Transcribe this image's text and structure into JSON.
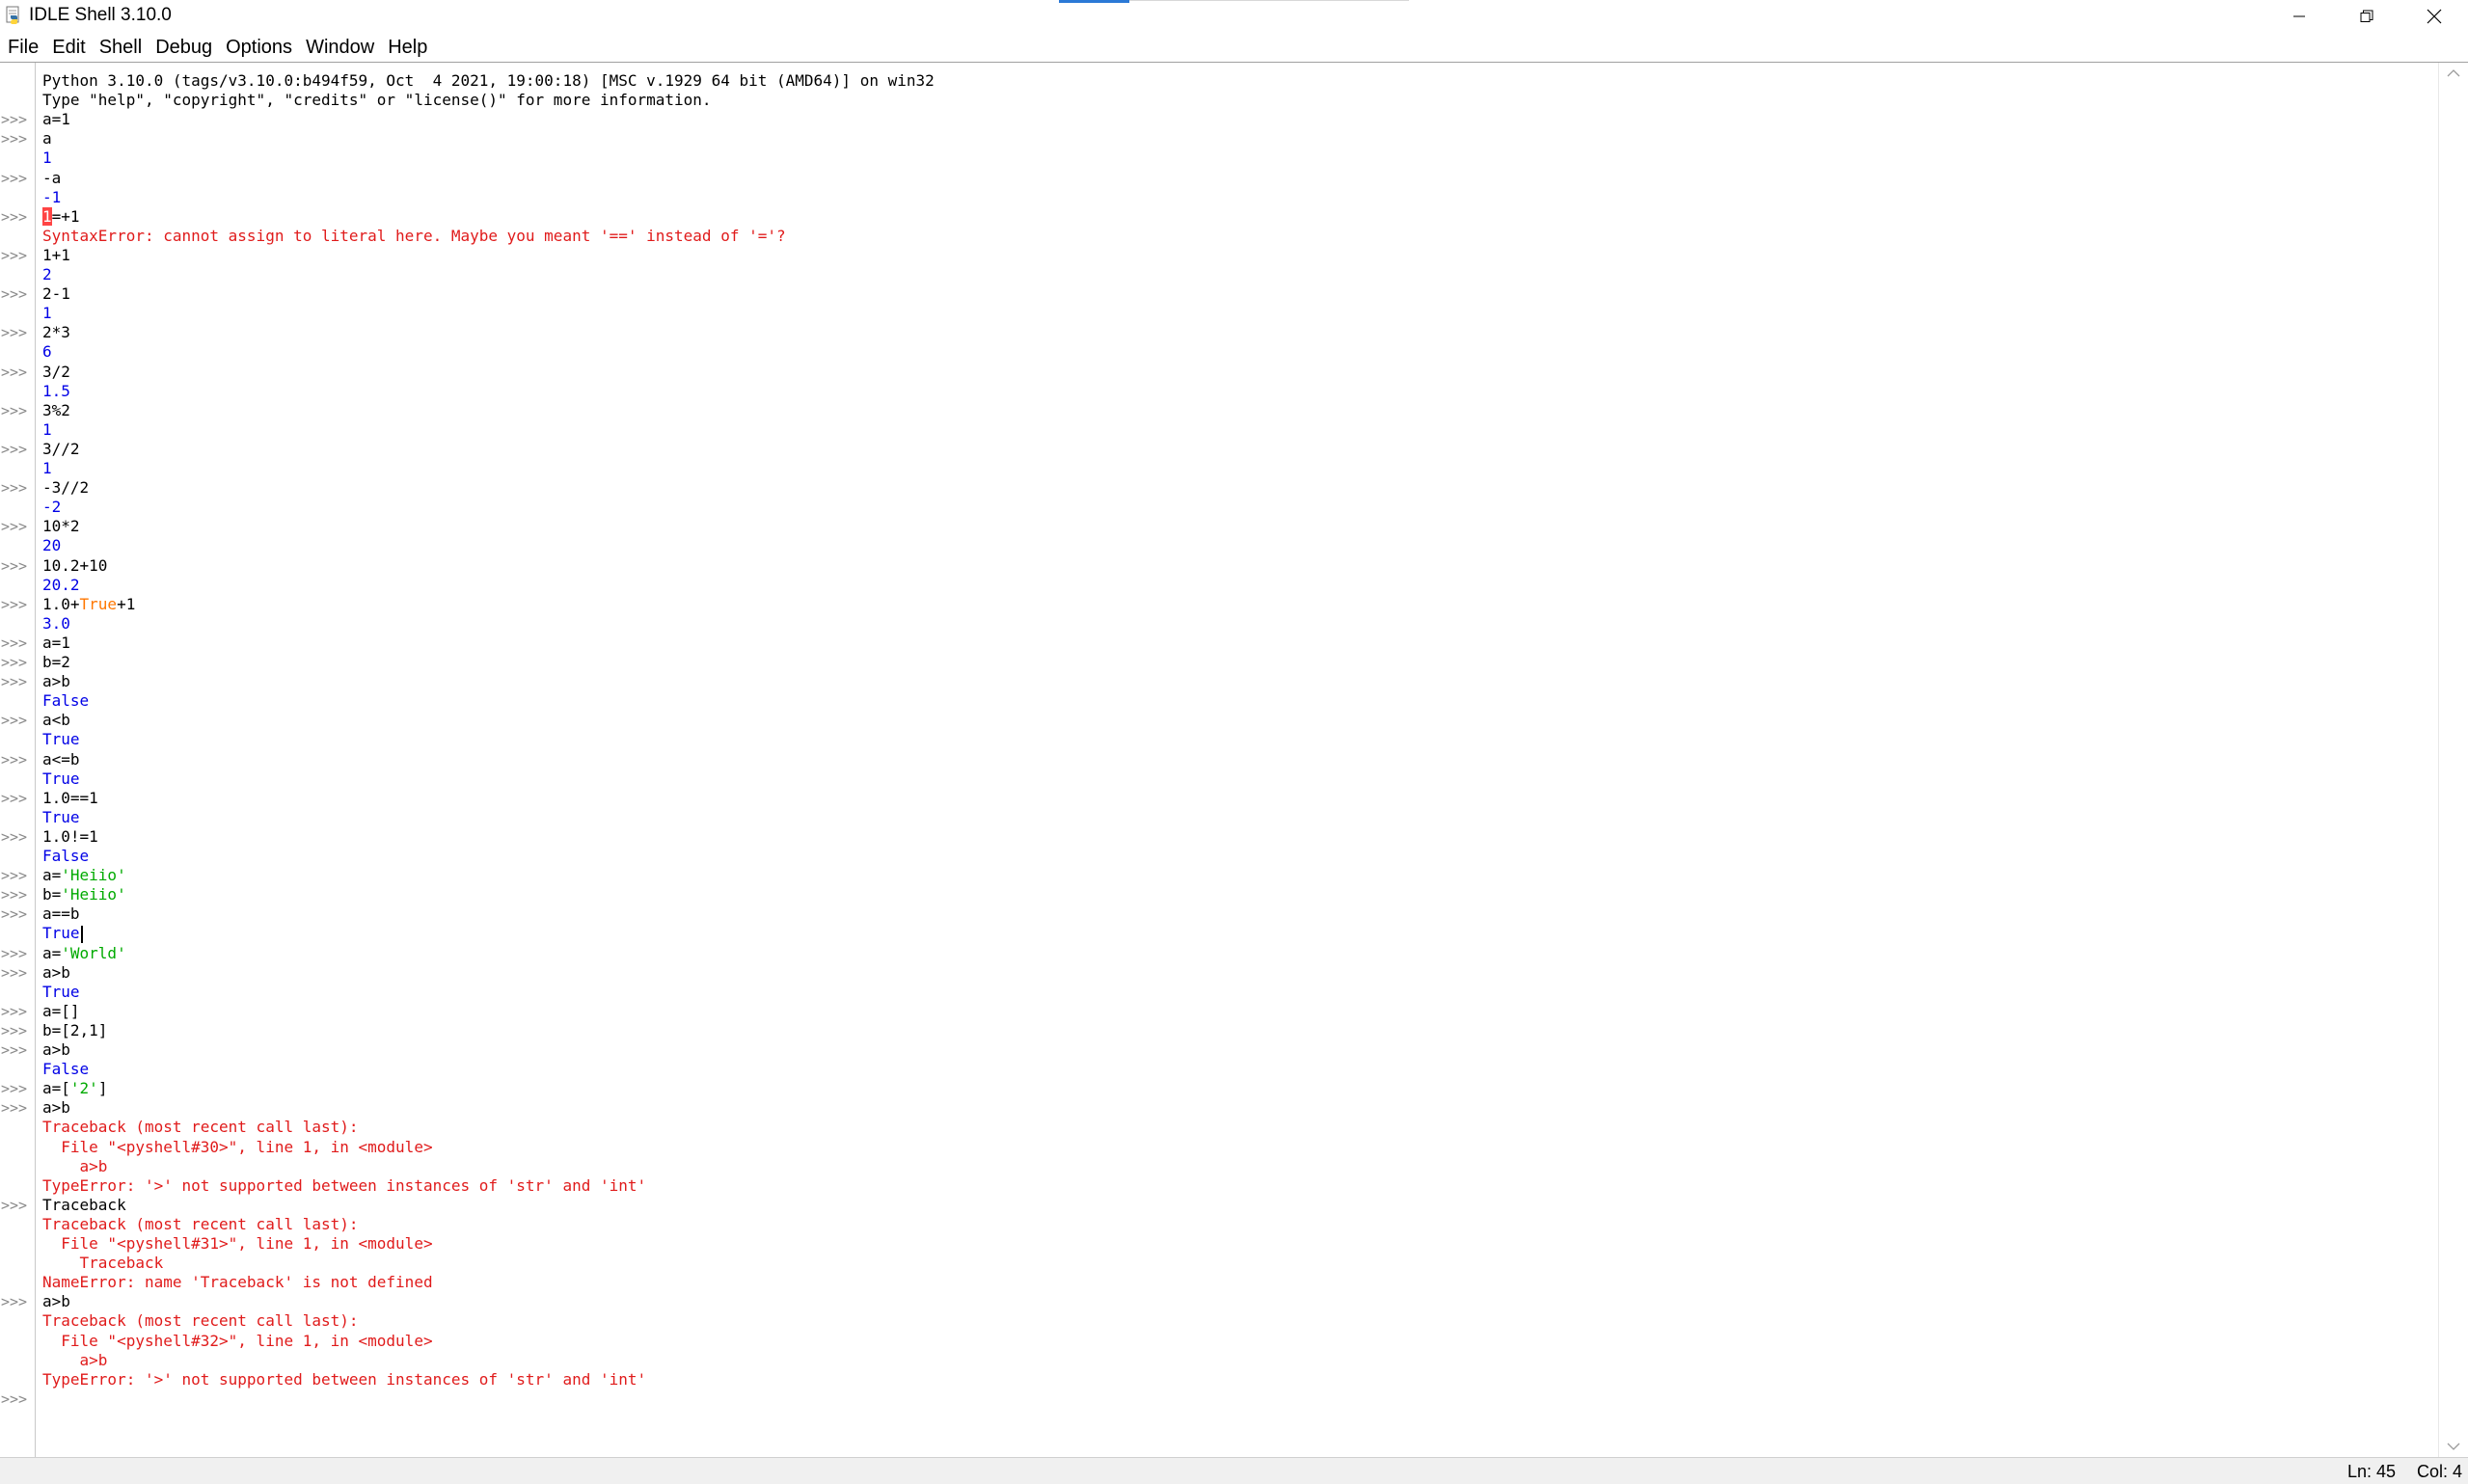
{
  "window": {
    "title": "IDLE Shell 3.10.0"
  },
  "menu": [
    "File",
    "Edit",
    "Shell",
    "Debug",
    "Options",
    "Window",
    "Help"
  ],
  "prompt_symbol": ">>>",
  "colors": {
    "input": "#000000",
    "output": "#0000e6",
    "error": "#e01b1b",
    "keyword": "#ff7700",
    "string": "#00aa00",
    "prompt": "#8a8a8a"
  },
  "shell_lines": [
    {
      "prompt": false,
      "kind": "in",
      "segments": [
        {
          "t": "Python 3.10.0 (tags/v3.10.0:b494f59, Oct  4 2021, 19:00:18) [MSC v.1929 64 bit (AMD64)] on win32"
        }
      ]
    },
    {
      "prompt": false,
      "kind": "in",
      "segments": [
        {
          "t": "Type \"help\", \"copyright\", \"credits\" or \"license()\" for more information."
        }
      ]
    },
    {
      "prompt": true,
      "kind": "in",
      "segments": [
        {
          "t": "a=1"
        }
      ]
    },
    {
      "prompt": true,
      "kind": "in",
      "segments": [
        {
          "t": "a"
        }
      ]
    },
    {
      "prompt": false,
      "kind": "out",
      "segments": [
        {
          "t": "1"
        }
      ]
    },
    {
      "prompt": true,
      "kind": "in",
      "segments": [
        {
          "t": "-a"
        }
      ]
    },
    {
      "prompt": false,
      "kind": "out",
      "segments": [
        {
          "t": "-1"
        }
      ]
    },
    {
      "prompt": true,
      "kind": "in",
      "segments": [
        {
          "t": "1",
          "c": "caret-hl"
        },
        {
          "t": "=+1"
        }
      ]
    },
    {
      "prompt": false,
      "kind": "err",
      "segments": [
        {
          "t": "SyntaxError: cannot assign to literal here. Maybe you meant '==' instead of '='?"
        }
      ]
    },
    {
      "prompt": true,
      "kind": "in",
      "segments": [
        {
          "t": "1+1"
        }
      ]
    },
    {
      "prompt": false,
      "kind": "out",
      "segments": [
        {
          "t": "2"
        }
      ]
    },
    {
      "prompt": true,
      "kind": "in",
      "segments": [
        {
          "t": "2-1"
        }
      ]
    },
    {
      "prompt": false,
      "kind": "out",
      "segments": [
        {
          "t": "1"
        }
      ]
    },
    {
      "prompt": true,
      "kind": "in",
      "segments": [
        {
          "t": "2*3"
        }
      ]
    },
    {
      "prompt": false,
      "kind": "out",
      "segments": [
        {
          "t": "6"
        }
      ]
    },
    {
      "prompt": true,
      "kind": "in",
      "segments": [
        {
          "t": "3/2"
        }
      ]
    },
    {
      "prompt": false,
      "kind": "out",
      "segments": [
        {
          "t": "1.5"
        }
      ]
    },
    {
      "prompt": true,
      "kind": "in",
      "segments": [
        {
          "t": "3%2"
        }
      ]
    },
    {
      "prompt": false,
      "kind": "out",
      "segments": [
        {
          "t": "1"
        }
      ]
    },
    {
      "prompt": true,
      "kind": "in",
      "segments": [
        {
          "t": "3//2"
        }
      ]
    },
    {
      "prompt": false,
      "kind": "out",
      "segments": [
        {
          "t": "1"
        }
      ]
    },
    {
      "prompt": true,
      "kind": "in",
      "segments": [
        {
          "t": "-3//2"
        }
      ]
    },
    {
      "prompt": false,
      "kind": "out",
      "segments": [
        {
          "t": "-2"
        }
      ]
    },
    {
      "prompt": true,
      "kind": "in",
      "segments": [
        {
          "t": "10*2"
        }
      ]
    },
    {
      "prompt": false,
      "kind": "out",
      "segments": [
        {
          "t": "20"
        }
      ]
    },
    {
      "prompt": true,
      "kind": "in",
      "segments": [
        {
          "t": "10.2+10"
        }
      ]
    },
    {
      "prompt": false,
      "kind": "out",
      "segments": [
        {
          "t": "20.2"
        }
      ]
    },
    {
      "prompt": true,
      "kind": "in",
      "segments": [
        {
          "t": "1.0+"
        },
        {
          "t": "True",
          "c": "c-kw"
        },
        {
          "t": "+1"
        }
      ]
    },
    {
      "prompt": false,
      "kind": "out",
      "segments": [
        {
          "t": "3.0"
        }
      ]
    },
    {
      "prompt": true,
      "kind": "in",
      "segments": [
        {
          "t": "a=1"
        }
      ]
    },
    {
      "prompt": true,
      "kind": "in",
      "segments": [
        {
          "t": "b=2"
        }
      ]
    },
    {
      "prompt": true,
      "kind": "in",
      "segments": [
        {
          "t": "a>b"
        }
      ]
    },
    {
      "prompt": false,
      "kind": "out",
      "segments": [
        {
          "t": "False"
        }
      ]
    },
    {
      "prompt": true,
      "kind": "in",
      "segments": [
        {
          "t": "a<b"
        }
      ]
    },
    {
      "prompt": false,
      "kind": "out",
      "segments": [
        {
          "t": "True"
        }
      ]
    },
    {
      "prompt": true,
      "kind": "in",
      "segments": [
        {
          "t": "a<=b"
        }
      ]
    },
    {
      "prompt": false,
      "kind": "out",
      "segments": [
        {
          "t": "True"
        }
      ]
    },
    {
      "prompt": true,
      "kind": "in",
      "segments": [
        {
          "t": "1.0==1"
        }
      ]
    },
    {
      "prompt": false,
      "kind": "out",
      "segments": [
        {
          "t": "True"
        }
      ]
    },
    {
      "prompt": true,
      "kind": "in",
      "segments": [
        {
          "t": "1.0!=1"
        }
      ]
    },
    {
      "prompt": false,
      "kind": "out",
      "segments": [
        {
          "t": "False"
        }
      ]
    },
    {
      "prompt": true,
      "kind": "in",
      "segments": [
        {
          "t": "a="
        },
        {
          "t": "'Heiio'",
          "c": "c-str"
        }
      ]
    },
    {
      "prompt": true,
      "kind": "in",
      "segments": [
        {
          "t": "b="
        },
        {
          "t": "'Heiio'",
          "c": "c-str"
        }
      ]
    },
    {
      "prompt": true,
      "kind": "in",
      "segments": [
        {
          "t": "a==b"
        }
      ]
    },
    {
      "prompt": false,
      "kind": "out",
      "segments": [
        {
          "t": "True"
        }
      ],
      "cursor": true
    },
    {
      "prompt": true,
      "kind": "in",
      "segments": [
        {
          "t": "a="
        },
        {
          "t": "'World'",
          "c": "c-str"
        }
      ]
    },
    {
      "prompt": true,
      "kind": "in",
      "segments": [
        {
          "t": "a>b"
        }
      ]
    },
    {
      "prompt": false,
      "kind": "out",
      "segments": [
        {
          "t": "True"
        }
      ]
    },
    {
      "prompt": true,
      "kind": "in",
      "segments": [
        {
          "t": "a=[]"
        }
      ]
    },
    {
      "prompt": true,
      "kind": "in",
      "segments": [
        {
          "t": "b=[2,1]"
        }
      ]
    },
    {
      "prompt": true,
      "kind": "in",
      "segments": [
        {
          "t": "a>b"
        }
      ]
    },
    {
      "prompt": false,
      "kind": "out",
      "segments": [
        {
          "t": "False"
        }
      ]
    },
    {
      "prompt": true,
      "kind": "in",
      "segments": [
        {
          "t": "a=["
        },
        {
          "t": "'2'",
          "c": "c-str"
        },
        {
          "t": "]"
        }
      ]
    },
    {
      "prompt": true,
      "kind": "in",
      "segments": [
        {
          "t": "a>b"
        }
      ]
    },
    {
      "prompt": false,
      "kind": "err",
      "segments": [
        {
          "t": "Traceback (most recent call last):"
        }
      ]
    },
    {
      "prompt": false,
      "kind": "err",
      "segments": [
        {
          "t": "  File \"<pyshell#30>\", line 1, in <module>"
        }
      ]
    },
    {
      "prompt": false,
      "kind": "err",
      "segments": [
        {
          "t": "    a>b"
        }
      ]
    },
    {
      "prompt": false,
      "kind": "err",
      "segments": [
        {
          "t": "TypeError: '>' not supported between instances of 'str' and 'int'"
        }
      ]
    },
    {
      "prompt": true,
      "kind": "in",
      "segments": [
        {
          "t": "Traceback"
        }
      ]
    },
    {
      "prompt": false,
      "kind": "err",
      "segments": [
        {
          "t": "Traceback (most recent call last):"
        }
      ]
    },
    {
      "prompt": false,
      "kind": "err",
      "segments": [
        {
          "t": "  File \"<pyshell#31>\", line 1, in <module>"
        }
      ]
    },
    {
      "prompt": false,
      "kind": "err",
      "segments": [
        {
          "t": "    Traceback"
        }
      ]
    },
    {
      "prompt": false,
      "kind": "err",
      "segments": [
        {
          "t": "NameError: name 'Traceback' is not defined"
        }
      ]
    },
    {
      "prompt": true,
      "kind": "in",
      "segments": [
        {
          "t": "a>b"
        }
      ]
    },
    {
      "prompt": false,
      "kind": "err",
      "segments": [
        {
          "t": "Traceback (most recent call last):"
        }
      ]
    },
    {
      "prompt": false,
      "kind": "err",
      "segments": [
        {
          "t": "  File \"<pyshell#32>\", line 1, in <module>"
        }
      ]
    },
    {
      "prompt": false,
      "kind": "err",
      "segments": [
        {
          "t": "    a>b"
        }
      ]
    },
    {
      "prompt": false,
      "kind": "err",
      "segments": [
        {
          "t": "TypeError: '>' not supported between instances of 'str' and 'int'"
        }
      ]
    },
    {
      "prompt": true,
      "kind": "in",
      "segments": []
    }
  ],
  "status": {
    "line": "Ln: 45",
    "col": "Col: 4"
  }
}
